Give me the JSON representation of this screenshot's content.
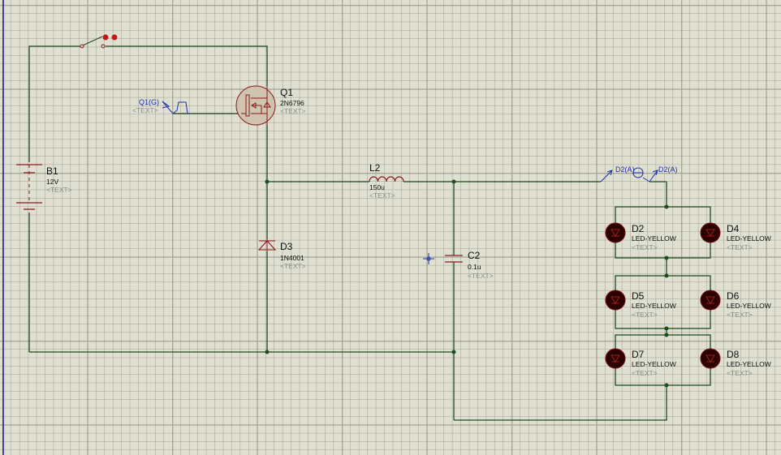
{
  "app": "Proteus ISIS schematic",
  "colors": {
    "background": "#e0e0d2",
    "wire": "#1f4d1f",
    "component": "#8b1a1a",
    "probe": "#1b2ea8",
    "led": "#2a0000"
  },
  "components": {
    "B1": {
      "ref": "B1",
      "value": "12V",
      "text": "<TEXT>"
    },
    "Q1": {
      "ref": "Q1",
      "value": "2N6796",
      "text": "<TEXT>"
    },
    "L2": {
      "ref": "L2",
      "value": "150u",
      "text": "<TEXT>"
    },
    "D3": {
      "ref": "D3",
      "value": "1N4001",
      "text": "<TEXT>"
    },
    "C2": {
      "ref": "C2",
      "value": "0.1u",
      "text": "<TEXT>"
    },
    "D2": {
      "ref": "D2",
      "value": "LED-YELLOW",
      "text": "<TEXT>"
    },
    "D4": {
      "ref": "D4",
      "value": "LED-YELLOW",
      "text": "<TEXT>"
    },
    "D5": {
      "ref": "D5",
      "value": "LED-YELLOW",
      "text": "<TEXT>"
    },
    "D6": {
      "ref": "D6",
      "value": "LED-YELLOW",
      "text": "<TEXT>"
    },
    "D7": {
      "ref": "D7",
      "value": "LED-YELLOW",
      "text": "<TEXT>"
    },
    "D8": {
      "ref": "D8",
      "value": "LED-YELLOW",
      "text": "<TEXT>"
    }
  },
  "generator": {
    "label": "Q1(G)",
    "text": "<TEXT>"
  },
  "probes": {
    "in_label": "D2(A)",
    "out_label": "D2(A)"
  },
  "icons": {
    "switch": "switch-icon",
    "generator": "pulse-generator-icon",
    "probe": "current-probe-icon",
    "origin": "crosshair-icon"
  }
}
